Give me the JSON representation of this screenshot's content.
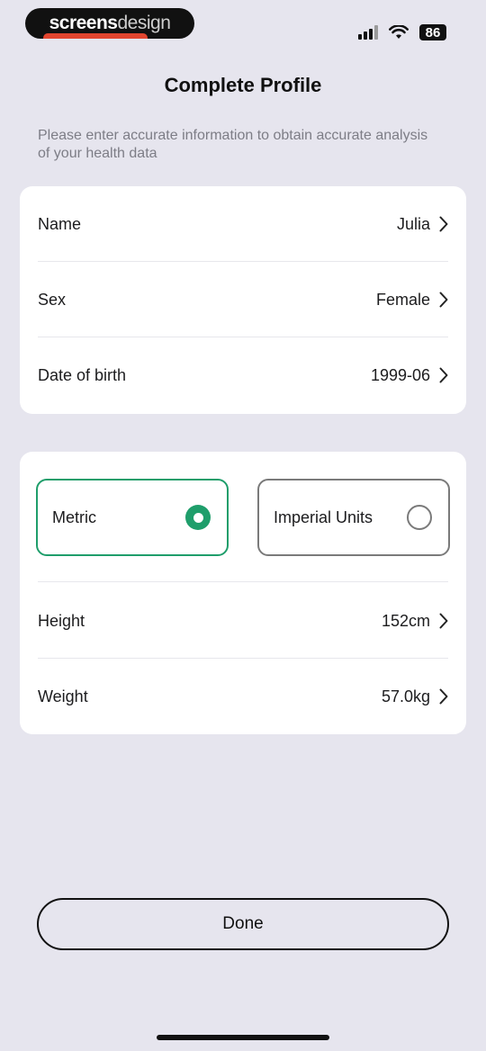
{
  "watermark": {
    "brand_bold": "screens",
    "brand_light": "design"
  },
  "status": {
    "battery": "86"
  },
  "header": {
    "title": "Complete Profile",
    "subtitle": "Please enter accurate information to obtain accurate analysis of your health data"
  },
  "profile": {
    "name_label": "Name",
    "name_value": "Julia",
    "sex_label": "Sex",
    "sex_value": "Female",
    "dob_label": "Date of birth",
    "dob_value": "1999-06"
  },
  "units": {
    "metric_label": "Metric",
    "imperial_label": "Imperial Units",
    "selected": "metric"
  },
  "body": {
    "height_label": "Height",
    "height_value": "152cm",
    "weight_label": "Weight",
    "weight_value": "57.0kg"
  },
  "actions": {
    "done_label": "Done"
  },
  "colors": {
    "accent": "#1f9e6b",
    "background": "#e6e5ee",
    "card": "#ffffff"
  }
}
